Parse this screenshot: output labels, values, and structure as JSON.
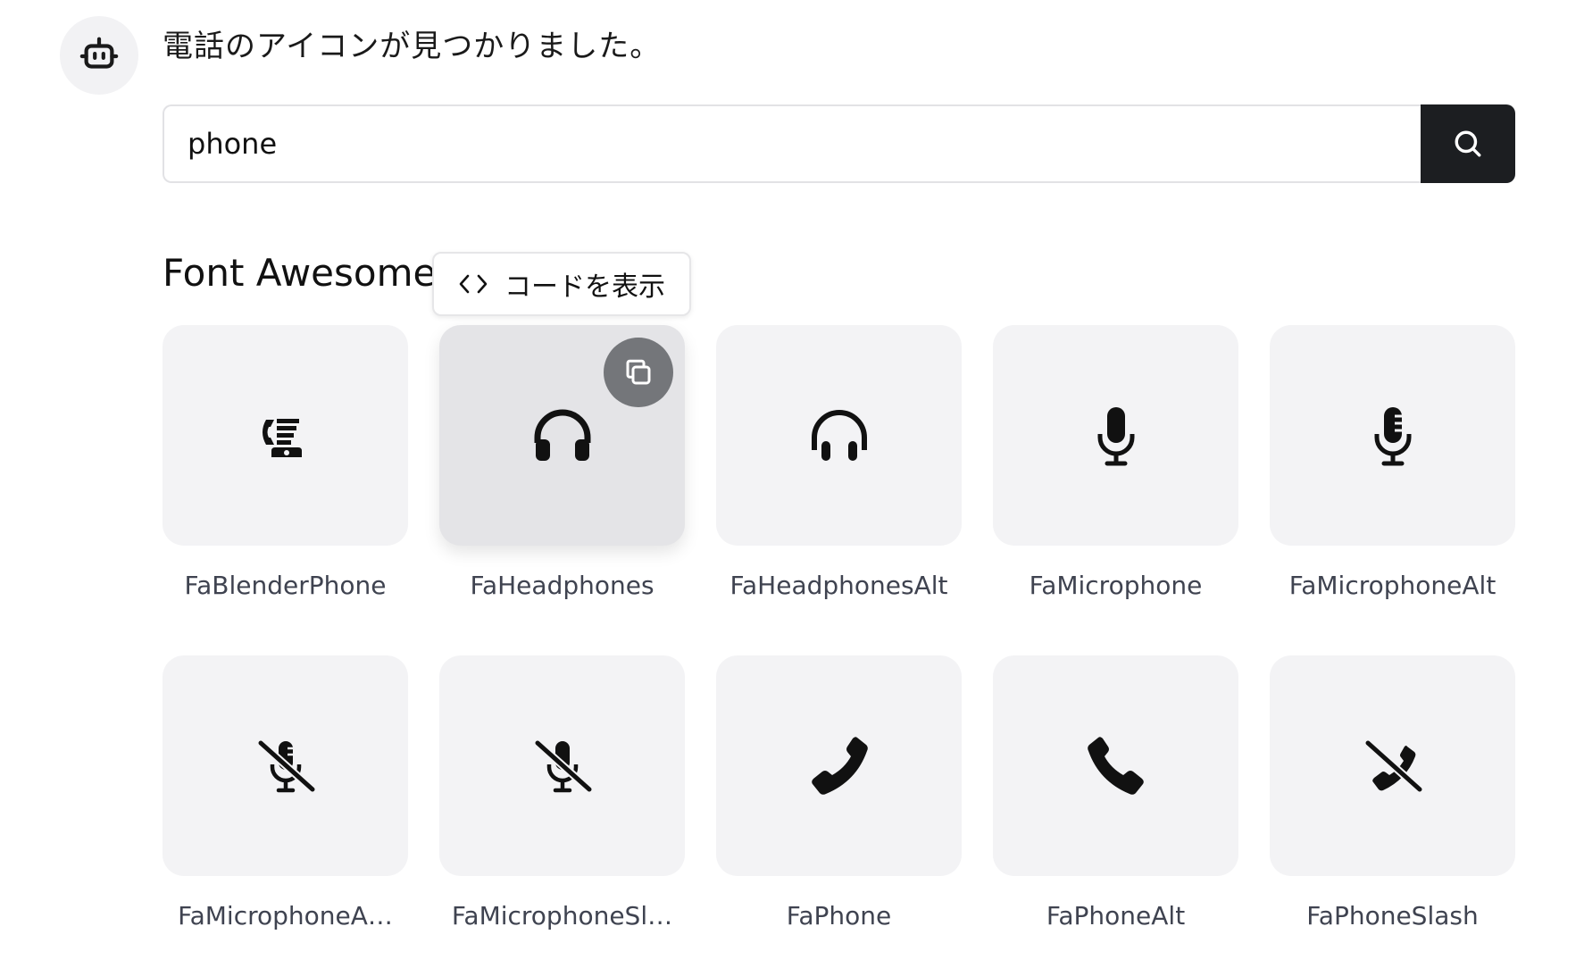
{
  "assistant": {
    "avatar_icon": "robot-icon",
    "message": "電話のアイコンが見つかりました。"
  },
  "search": {
    "value": "phone",
    "button_icon": "search-icon"
  },
  "section": {
    "title": "Font Awesome",
    "show_code_label": "コードを表示",
    "show_code_icon": "code-brackets-icon"
  },
  "icons": [
    {
      "label": "FaBlenderPhone",
      "icon": "blender-phone-icon"
    },
    {
      "label": "FaHeadphones",
      "icon": "headphones-icon",
      "hovered": true,
      "copy_icon": "copy-icon"
    },
    {
      "label": "FaHeadphonesAlt",
      "icon": "headphones-alt-icon"
    },
    {
      "label": "FaMicrophone",
      "icon": "microphone-icon"
    },
    {
      "label": "FaMicrophoneAlt",
      "icon": "microphone-alt-icon"
    },
    {
      "label": "FaMicrophoneA…",
      "icon": "microphone-alt-slash-icon"
    },
    {
      "label": "FaMicrophoneSl…",
      "icon": "microphone-slash-icon"
    },
    {
      "label": "FaPhone",
      "icon": "phone-icon"
    },
    {
      "label": "FaPhoneAlt",
      "icon": "phone-alt-icon"
    },
    {
      "label": "FaPhoneSlash",
      "icon": "phone-slash-icon"
    }
  ],
  "colors": {
    "tile_bg": "#f3f3f5",
    "tile_hover_bg": "#e4e4e7",
    "search_button_bg": "#1c1e21",
    "copy_button_bg": "#74767a",
    "label_text": "#3f4350"
  }
}
